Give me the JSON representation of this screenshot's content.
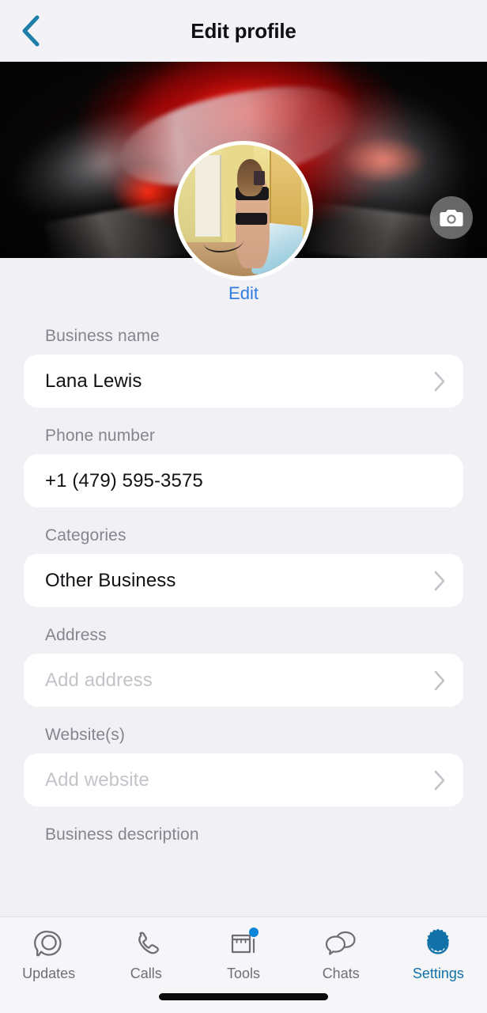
{
  "header": {
    "title": "Edit profile",
    "back_icon": "chevron-left-icon",
    "back_color": "#1d7ea8"
  },
  "cover": {
    "camera_icon": "camera-icon",
    "description": "dark red rose with grey smoke cover photo"
  },
  "profile": {
    "avatar_alt": "profile photo",
    "edit_label": "Edit",
    "edit_color": "#2f7de0"
  },
  "form": {
    "fields": [
      {
        "label": "Business name",
        "value": "Lana Lewis",
        "placeholder": "",
        "is_placeholder": false,
        "has_chevron": true,
        "name": "business-name"
      },
      {
        "label": "Phone number",
        "value": "+1 (479) 595-3575",
        "placeholder": "",
        "is_placeholder": false,
        "has_chevron": false,
        "name": "phone-number"
      },
      {
        "label": "Categories",
        "value": "Other Business",
        "placeholder": "",
        "is_placeholder": false,
        "has_chevron": true,
        "name": "categories"
      },
      {
        "label": "Address",
        "value": "Add address",
        "placeholder": "Add address",
        "is_placeholder": true,
        "has_chevron": true,
        "name": "address"
      },
      {
        "label": "Website(s)",
        "value": "Add website",
        "placeholder": "Add website",
        "is_placeholder": true,
        "has_chevron": true,
        "name": "websites"
      }
    ],
    "last_partial_label": "Business description"
  },
  "tabbar": {
    "active_color": "#1272a8",
    "inactive_color": "#6e6e76",
    "badge_color": "#0a84d8",
    "tabs": [
      {
        "label": "Updates",
        "icon": "status-ring-icon",
        "active": false,
        "badge": false
      },
      {
        "label": "Calls",
        "icon": "phone-icon",
        "active": false,
        "badge": false
      },
      {
        "label": "Tools",
        "icon": "storefront-icon",
        "active": false,
        "badge": true
      },
      {
        "label": "Chats",
        "icon": "chat-bubbles-icon",
        "active": false,
        "badge": false
      },
      {
        "label": "Settings",
        "icon": "gear-icon",
        "active": true,
        "badge": false
      }
    ]
  }
}
